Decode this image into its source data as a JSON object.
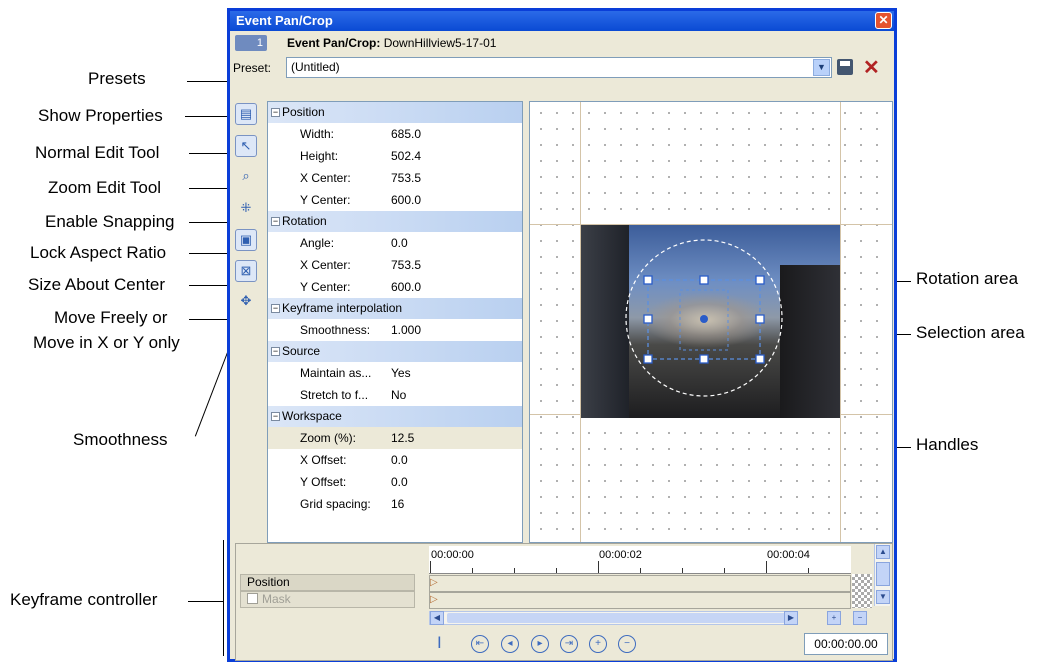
{
  "window": {
    "title": "Event Pan/Crop",
    "header_label": "Event Pan/Crop:",
    "header_value": "DownHillview5-17-01",
    "track_number": "1"
  },
  "preset": {
    "label": "Preset:",
    "value": "(Untitled)"
  },
  "callouts_left": {
    "presets": "Presets",
    "show_properties": "Show Properties",
    "normal_edit": "Normal Edit Tool",
    "zoom_edit": "Zoom Edit Tool",
    "enable_snapping": "Enable Snapping",
    "lock_aspect": "Lock Aspect Ratio",
    "size_about_center": "Size About Center",
    "move_freely_1": "Move Freely or",
    "move_freely_2": "Move in X or Y only",
    "smoothness": "Smoothness",
    "keyframe_controller": "Keyframe controller"
  },
  "callouts_right": {
    "rotation_area": "Rotation area",
    "selection_area": "Selection area",
    "handles": "Handles"
  },
  "properties": {
    "position": {
      "header": "Position",
      "rows": [
        {
          "name": "Width:",
          "value": "685.0"
        },
        {
          "name": "Height:",
          "value": "502.4"
        },
        {
          "name": "X Center:",
          "value": "753.5"
        },
        {
          "name": "Y Center:",
          "value": "600.0"
        }
      ]
    },
    "rotation": {
      "header": "Rotation",
      "rows": [
        {
          "name": "Angle:",
          "value": "0.0"
        },
        {
          "name": "X Center:",
          "value": "753.5"
        },
        {
          "name": "Y Center:",
          "value": "600.0"
        }
      ]
    },
    "keyframe": {
      "header": "Keyframe interpolation",
      "rows": [
        {
          "name": "Smoothness:",
          "value": "1.000"
        }
      ]
    },
    "source": {
      "header": "Source",
      "rows": [
        {
          "name": "Maintain as...",
          "value": "Yes"
        },
        {
          "name": "Stretch to f...",
          "value": "No"
        }
      ]
    },
    "workspace": {
      "header": "Workspace",
      "rows": [
        {
          "name": "Zoom (%):",
          "value": "12.5"
        },
        {
          "name": "X Offset:",
          "value": "0.0"
        },
        {
          "name": "Y Offset:",
          "value": "0.0"
        },
        {
          "name": "Grid spacing:",
          "value": "16"
        }
      ]
    }
  },
  "keyframes": {
    "tracks": [
      {
        "label": "Position"
      },
      {
        "label": "Mask"
      }
    ],
    "ruler": [
      "00:00:00",
      "00:00:02",
      "00:00:04"
    ],
    "timecode": "00:00:00.00"
  },
  "colors": {
    "titlebar": "#0a4ad4",
    "panel_bg": "#ece9d8",
    "accent": "#3d6bbf"
  }
}
